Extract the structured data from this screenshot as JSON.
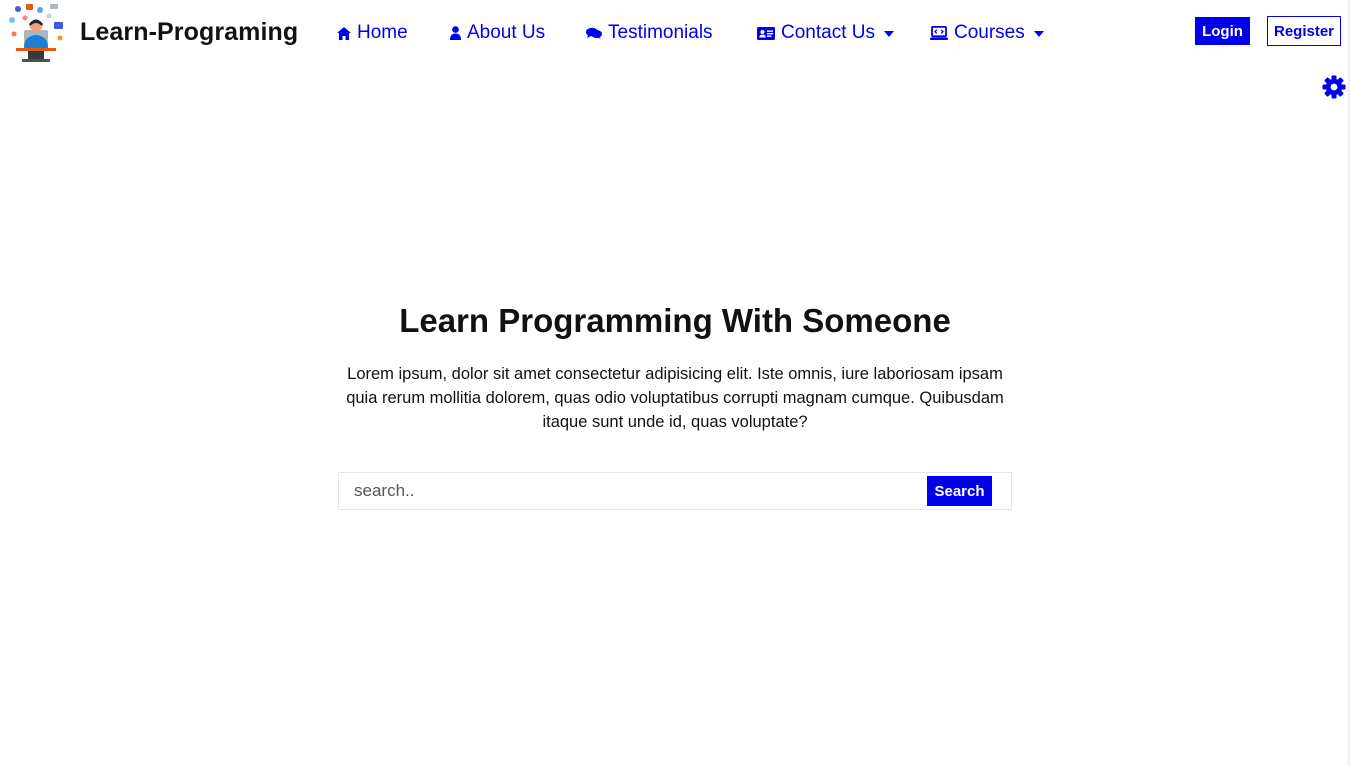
{
  "brand": {
    "name": "Learn-Programing",
    "logo_icon": "programmer-illustration-icon"
  },
  "nav": {
    "items": [
      {
        "label": "Home",
        "icon": "home-icon"
      },
      {
        "label": "About Us",
        "icon": "user-icon"
      },
      {
        "label": "Testimonials",
        "icon": "comments-icon"
      },
      {
        "label": "Contact Us",
        "icon": "address-card-icon",
        "dropdown": true
      },
      {
        "label": "Courses",
        "icon": "laptop-code-icon",
        "dropdown": true
      }
    ]
  },
  "auth": {
    "login_label": "Login",
    "register_label": "Register"
  },
  "settings": {
    "icon": "gear-icon"
  },
  "hero": {
    "title": "Learn Programming With Someone",
    "description": "Lorem ipsum, dolor sit amet consectetur adipisicing elit. Iste omnis, iure laboriosam ipsam quia rerum mollitia dolorem, quas odio voluptatibus corrupti magnam cumque. Quibusdam itaque sunt unde id, quas voluptate?"
  },
  "search": {
    "placeholder": "search..",
    "value": "",
    "button_label": "Search"
  },
  "colors": {
    "accent": "#0000ee",
    "text": "#111111",
    "background": "#ffffff"
  }
}
